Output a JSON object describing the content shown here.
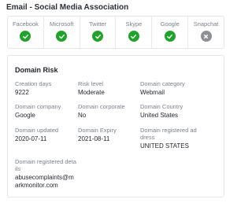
{
  "section_title": "Email - Social Media Association",
  "associations": [
    {
      "name": "Facebook",
      "status": "connected",
      "icon": "check-icon"
    },
    {
      "name": "Microsoft",
      "status": "connected",
      "icon": "check-icon"
    },
    {
      "name": "Twitter",
      "status": "connected",
      "icon": "check-icon"
    },
    {
      "name": "Skype",
      "status": "connected",
      "icon": "check-icon"
    },
    {
      "name": "Google",
      "status": "connected",
      "icon": "check-icon"
    },
    {
      "name": "Snapchat",
      "status": "not-connected",
      "icon": "x-icon"
    }
  ],
  "colors": {
    "connected": "#1fa32b",
    "not_connected": "#8d8f93"
  },
  "domain_risk": {
    "title": "Domain Risk",
    "fields": [
      {
        "label": "Creation days",
        "value": "9222"
      },
      {
        "label": "Risk level",
        "value": "Moderate"
      },
      {
        "label": "Domain category",
        "value": "Webmail"
      },
      {
        "label": "Domain company",
        "value": "Google"
      },
      {
        "label": "Domain corporate",
        "value": "No"
      },
      {
        "label": "Domain Country",
        "value": "United States"
      },
      {
        "label": "Domain updated",
        "value": "2020-07-11"
      },
      {
        "label": "Domain Expiry",
        "value": "2021-08-11"
      },
      {
        "label": "Domain registered address",
        "value": "UNITED STATES"
      },
      {
        "label": "Domain registered details",
        "value": "abusecomplaints@markmonitor.com"
      }
    ]
  }
}
